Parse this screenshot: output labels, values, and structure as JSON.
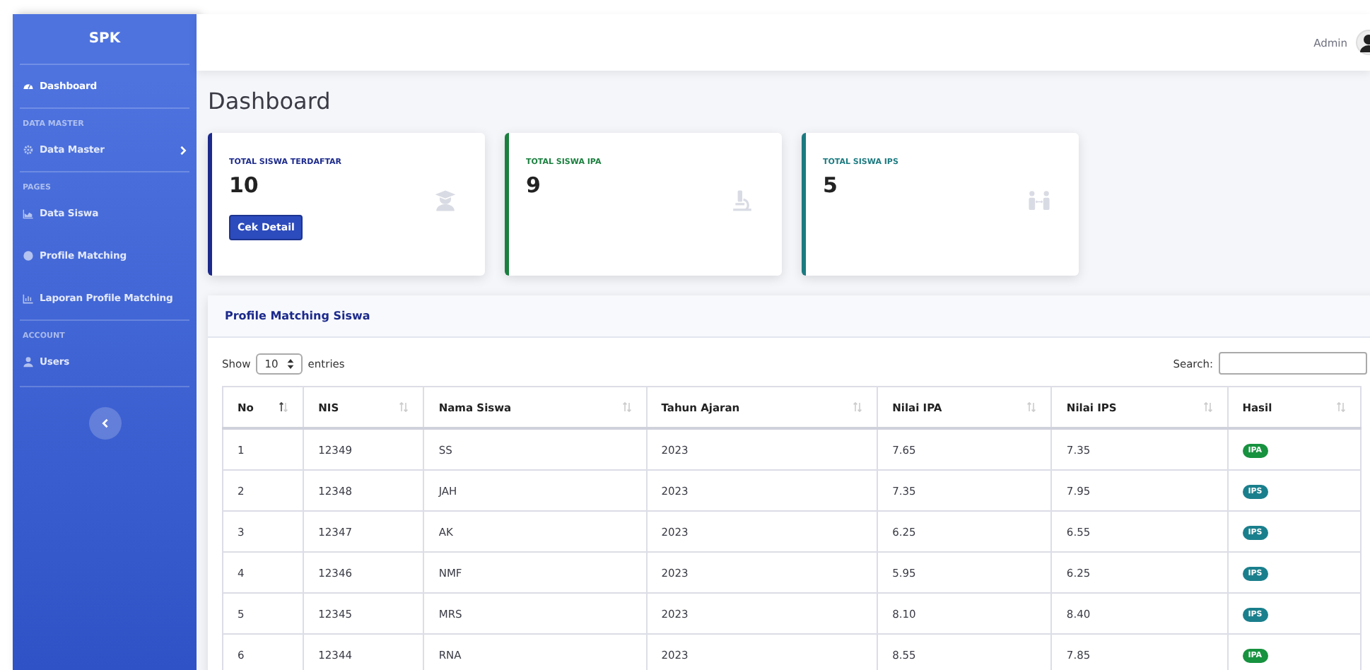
{
  "sidebar": {
    "brand": "SPK",
    "items": [
      {
        "kind": "link",
        "label": "Dashboard",
        "selected": true
      },
      {
        "kind": "heading",
        "label": "DATA MASTER"
      },
      {
        "kind": "submenu",
        "label": "Data Master",
        "selected": false
      },
      {
        "kind": "heading",
        "label": "PAGES"
      },
      {
        "kind": "link",
        "label": "Data Siswa",
        "selected": false
      },
      {
        "kind": "link",
        "label": "Profile Matching",
        "selected": false
      },
      {
        "kind": "link",
        "label": "Laporan Profile Matching",
        "selected": false
      },
      {
        "kind": "heading",
        "label": "ACCOUNT"
      },
      {
        "kind": "link",
        "label": "Users",
        "selected": false
      }
    ]
  },
  "topbar": {
    "user": "Admin"
  },
  "page_title": "Dashboard",
  "cards": [
    {
      "label": "TOTAL SISWA TERDAFTAR",
      "value": "10",
      "color": "#1c2a8c",
      "button": "Cek Detail"
    },
    {
      "label": "TOTAL SISWA IPA",
      "value": "9",
      "color": "#1a7f3e"
    },
    {
      "label": "TOTAL SISWA IPS",
      "value": "5",
      "color": "#1b7a80"
    }
  ],
  "table_card": {
    "title": "Profile Matching Siswa",
    "show_label": "Show",
    "page_size": "10",
    "entries_label": "entries",
    "search_label": "Search:",
    "columns": [
      {
        "label": "No",
        "sorted": true
      },
      {
        "label": "NIS",
        "sorted": false
      },
      {
        "label": "Nama Siswa",
        "sorted": false
      },
      {
        "label": "Tahun Ajaran",
        "sorted": false
      },
      {
        "label": "Nilai IPA",
        "sorted": false
      },
      {
        "label": "Nilai IPS",
        "sorted": false
      },
      {
        "label": "Hasil",
        "sorted": false
      }
    ],
    "rows": [
      {
        "cells": [
          "1",
          "12349",
          "SS",
          "2023",
          "7.65",
          "7.35"
        ],
        "hasil": {
          "label": "IPA",
          "color": "#17923f"
        }
      },
      {
        "cells": [
          "2",
          "12348",
          "JAH",
          "2023",
          "7.35",
          "7.95"
        ],
        "hasil": {
          "label": "IPS",
          "color": "#1a7f8c"
        }
      },
      {
        "cells": [
          "3",
          "12347",
          "AK",
          "2023",
          "6.25",
          "6.55"
        ],
        "hasil": {
          "label": "IPS",
          "color": "#1a7f8c"
        }
      },
      {
        "cells": [
          "4",
          "12346",
          "NMF",
          "2023",
          "5.95",
          "6.25"
        ],
        "hasil": {
          "label": "IPS",
          "color": "#1a7f8c"
        }
      },
      {
        "cells": [
          "5",
          "12345",
          "MRS",
          "2023",
          "8.10",
          "8.40"
        ],
        "hasil": {
          "label": "IPS",
          "color": "#1a7f8c"
        }
      },
      {
        "cells": [
          "6",
          "12344",
          "RNA",
          "2023",
          "8.55",
          "7.85"
        ],
        "hasil": {
          "label": "IPA",
          "color": "#17923f"
        }
      }
    ]
  }
}
